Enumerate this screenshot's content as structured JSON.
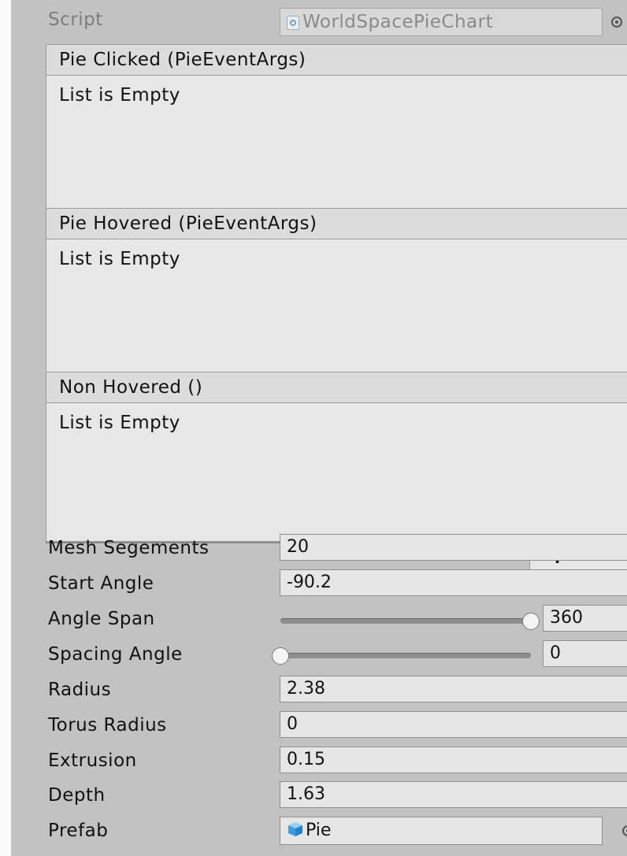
{
  "script": {
    "label": "Script",
    "value": "WorldSpacePieChart",
    "icon": "csharp-script-icon"
  },
  "events": [
    {
      "header": "Pie Clicked (PieEventArgs)",
      "empty_text": "List is Empty",
      "add": "+",
      "remove": "−"
    },
    {
      "header": "Pie Hovered (PieEventArgs)",
      "empty_text": "List is Empty",
      "add": "+",
      "remove": "−"
    },
    {
      "header": "Non Hovered ()",
      "empty_text": "List is Empty",
      "add": "+",
      "remove": "−"
    }
  ],
  "fields": {
    "mesh_segments": {
      "label": "Mesh Segements",
      "value": "20"
    },
    "start_angle": {
      "label": "Start Angle",
      "value": "-90.2"
    },
    "angle_span": {
      "label": "Angle Span",
      "value": "360",
      "slider_fraction": 1.0
    },
    "spacing_angle": {
      "label": "Spacing Angle",
      "value": "0",
      "slider_fraction": 0.0
    },
    "radius": {
      "label": "Radius",
      "value": "2.38"
    },
    "torus_radius": {
      "label": "Torus Radius",
      "value": "0"
    },
    "extrusion": {
      "label": "Extrusion",
      "value": "0.15"
    },
    "depth": {
      "label": "Depth",
      "value": "1.63"
    },
    "prefab": {
      "label": "Prefab",
      "value": "Pie",
      "icon": "prefab-cube-icon"
    }
  },
  "colors": {
    "panel_bg": "#c2c2c2",
    "field_bg": "#e6e6e6",
    "prefab_icon": "#3d9be0"
  }
}
